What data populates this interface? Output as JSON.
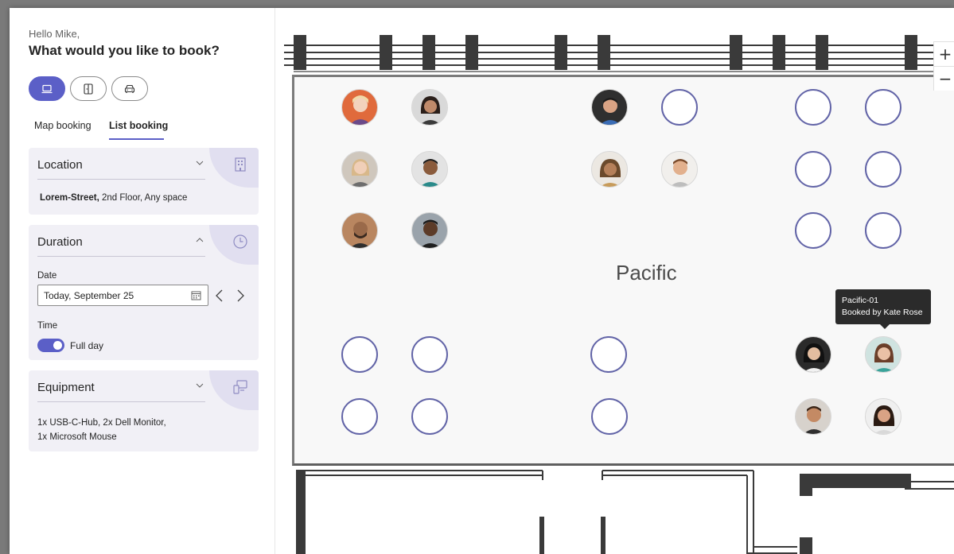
{
  "sidebar": {
    "greeting": "Hello Mike,",
    "question": "What would you like to book?",
    "booking_types": [
      {
        "name": "desk",
        "icon": "laptop-icon",
        "active": true
      },
      {
        "name": "room",
        "icon": "door-icon",
        "active": false
      },
      {
        "name": "parking",
        "icon": "car-icon",
        "active": false
      }
    ],
    "tabs": [
      {
        "label": "Map booking",
        "active": false
      },
      {
        "label": "List booking",
        "active": true
      }
    ],
    "location": {
      "title": "Location",
      "street": "Lorem-Street,",
      "detail": " 2nd Floor, Any space"
    },
    "duration": {
      "title": "Duration",
      "date_label": "Date",
      "date_value": "Today, September 25",
      "time_label": "Time",
      "full_day_label": "Full day",
      "full_day_on": true
    },
    "equipment": {
      "title": "Equipment",
      "line1": "1x USB-C-Hub, 2x Dell Monitor,",
      "line2": "1x Microsoft Mouse"
    }
  },
  "map": {
    "room_name": "Pacific",
    "tooltip": {
      "seat": "Pacific-01",
      "booked_by": "Booked by Kate Rose"
    },
    "zoom_in": "+",
    "zoom_out": "−"
  },
  "colors": {
    "accent": "#5b5fc7",
    "seat_outline": "#6264a7",
    "card_bg": "#f1f0f6"
  }
}
